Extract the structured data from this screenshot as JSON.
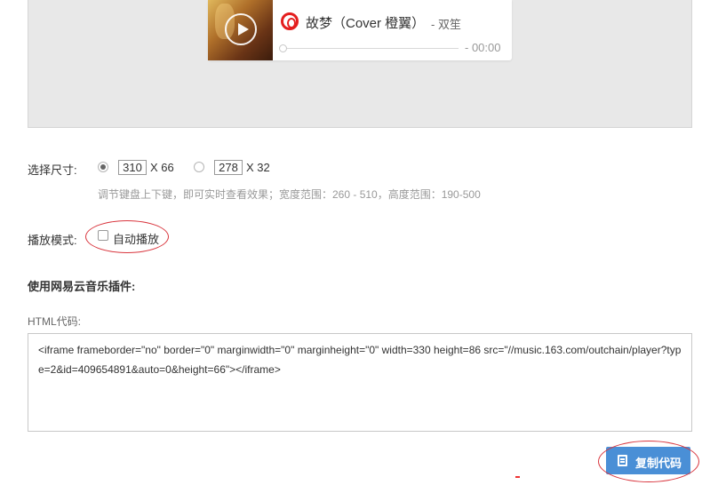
{
  "player": {
    "song_title": "故梦（Cover 橙翼）",
    "song_artist": "- 双笙",
    "time": "- 00:00",
    "icons": [
      "play-icon",
      "netease-music-logo-icon"
    ]
  },
  "size": {
    "label": "选择尺寸:",
    "options": [
      {
        "width_value": "310",
        "height_text": "X 66",
        "selected": true
      },
      {
        "width_value": "278",
        "height_text": "X 32",
        "selected": false
      }
    ],
    "hint": "调节键盘上下键，即可实时查看效果；宽度范围：260 - 510，高度范围：190-500"
  },
  "play_mode": {
    "label": "播放模式:",
    "autoplay_label": "自动播放",
    "autoplay_checked": false
  },
  "plugin": {
    "title": "使用网易云音乐插件:",
    "html_label": "HTML代码:",
    "code": "<iframe frameborder=\"no\" border=\"0\" marginwidth=\"0\" marginheight=\"0\" width=330 height=86 src=\"//music.163.com/outchain/player?type=2&id=409654891&auto=0&height=66\"></iframe>"
  },
  "copy_button": {
    "label": "复制代码"
  },
  "colors": {
    "accent_blue": "#4a8fd6",
    "annotation_red": "#d9363e",
    "brand_red": "#e41e1e"
  }
}
